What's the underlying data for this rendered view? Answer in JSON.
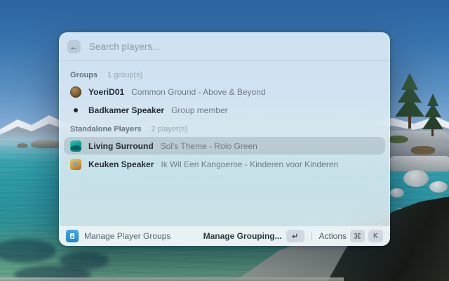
{
  "window": {
    "search": {
      "placeholder": "Search players...",
      "back_icon": "left-arrow"
    },
    "sections": [
      {
        "label": "Groups",
        "count": "1 group(s)",
        "rows": [
          {
            "icon": "round-album-art",
            "title": "YoeriD01",
            "subtitle": "Common Ground - Above & Beyond",
            "selected": false
          },
          {
            "icon": "bullet-dot",
            "title": "Badkamer Speaker",
            "subtitle": "Group member",
            "selected": false
          }
        ]
      },
      {
        "label": "Standalone Players",
        "count": "2 player(s)",
        "rows": [
          {
            "icon": "teal-album-art",
            "title": "Living Surround",
            "subtitle": "Sol's Theme - Rolo Green",
            "selected": true
          },
          {
            "icon": "yellow-album-art",
            "title": "Keuken Speaker",
            "subtitle": "Ik Wil Een Kangoeroe - Kinderen voor Kinderen",
            "selected": false
          }
        ]
      }
    ],
    "footer": {
      "left_label": "Manage Player Groups",
      "primary_action": "Manage Grouping...",
      "return_key": "↵",
      "actions_label": "Actions",
      "cmd_key": "⌘",
      "k_key": "K"
    }
  },
  "icons": {
    "back": "←"
  },
  "colors": {
    "accent_blue": "#2b99e0",
    "selection_gray": "#96a2ac",
    "panel_tint": "#e2eef8",
    "lake_teal": "#2b97a4",
    "sky_blue": "#3a74ae"
  }
}
